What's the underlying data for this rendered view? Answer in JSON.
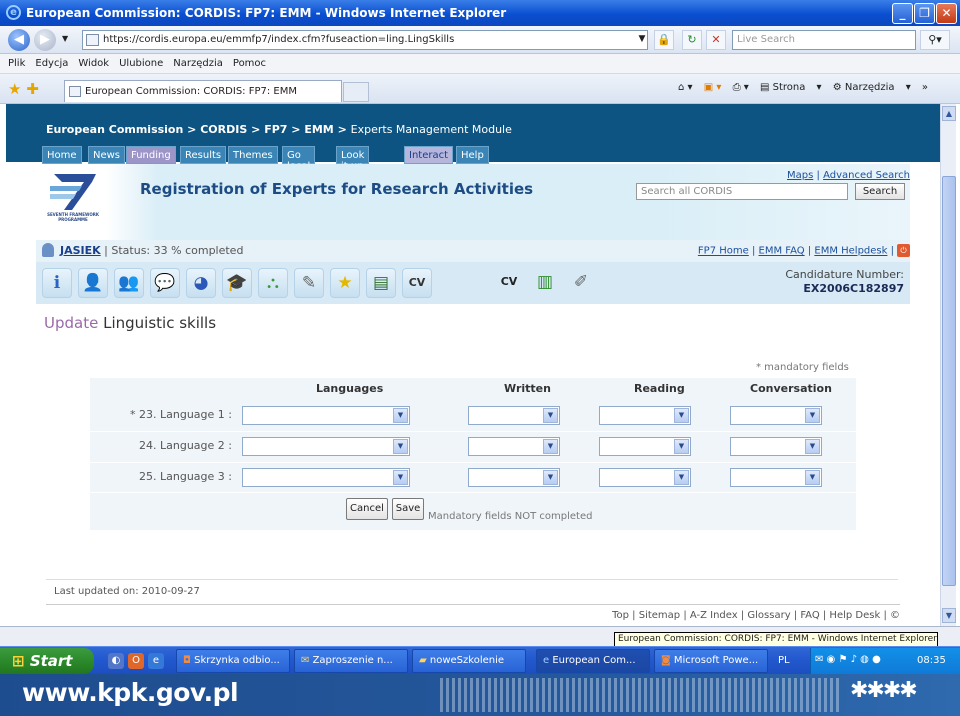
{
  "window": {
    "title": "European Commission: CORDIS: FP7: EMM - Windows Internet Explorer"
  },
  "address": {
    "url": "https://cordis.europa.eu/emmfp7/index.cfm?fuseaction=ling.LingSkills",
    "search_placeholder": "Live Search"
  },
  "menu": [
    "Plik",
    "Edycja",
    "Widok",
    "Ulubione",
    "Narzędzia",
    "Pomoc"
  ],
  "browser_tab": {
    "title": "European Commission: CORDIS: FP7: EMM"
  },
  "browser_tools": {
    "strona": "Strona",
    "narzedzia": "Narzędzia"
  },
  "site": {
    "breadcrumb": {
      "ec": "European Commission",
      "cordis": "CORDIS",
      "fp7": "FP7",
      "emm": "EMM",
      "current": "Experts Management Module",
      "sep": ">"
    },
    "nav": [
      "Home",
      "News",
      "Funding",
      "Results",
      "Themes",
      "Go local",
      "Look it up",
      "Interact",
      "Help"
    ],
    "banner_title": "Registration of Experts for Research Activities",
    "logo_text": "SEVENTH FRAMEWORK PROGRAMME",
    "maps": "Maps",
    "advanced_search": "Advanced Search",
    "search_placeholder": "Search all CORDIS",
    "search_button": "Search",
    "user": {
      "name": "JASIEK",
      "status": "| Status: 33 % completed"
    },
    "links": {
      "fp7home": "FP7 Home",
      "faq": "EMM FAQ",
      "helpdesk": "EMM Helpdesk"
    },
    "candidature": {
      "label": "Candidature Number:",
      "number": "EX2006C182897"
    }
  },
  "page": {
    "title_update": "Update",
    "title_rest": "Linguistic skills",
    "mandatory_note": "* mandatory fields",
    "columns": [
      "Languages",
      "Written",
      "Reading",
      "Conversation"
    ],
    "rows": [
      {
        "label": "* 23. Language 1 :"
      },
      {
        "label": "24. Language 2 :"
      },
      {
        "label": "25. Language 3 :"
      }
    ],
    "cancel": "Cancel",
    "save": "Save",
    "status_note": "Mandatory fields NOT completed",
    "last_updated": "Last updated on: 2010-09-27",
    "footer": "Top | Sitemap | A-Z Index | Glossary | FAQ | Help Desk | ©"
  },
  "statusbar": {
    "tooltip": "European Commission: CORDIS: FP7: EMM - Windows Internet Explorer"
  },
  "taskbar": {
    "start": "Start",
    "items": [
      "Skrzynka odbio...",
      "Zaproszenie n...",
      "noweSzkolenie",
      "European Com...",
      "Microsoft Powe..."
    ],
    "lang": "PL",
    "time": "08:35"
  },
  "slide_footer": {
    "url": "www.kpk.gov.pl"
  }
}
